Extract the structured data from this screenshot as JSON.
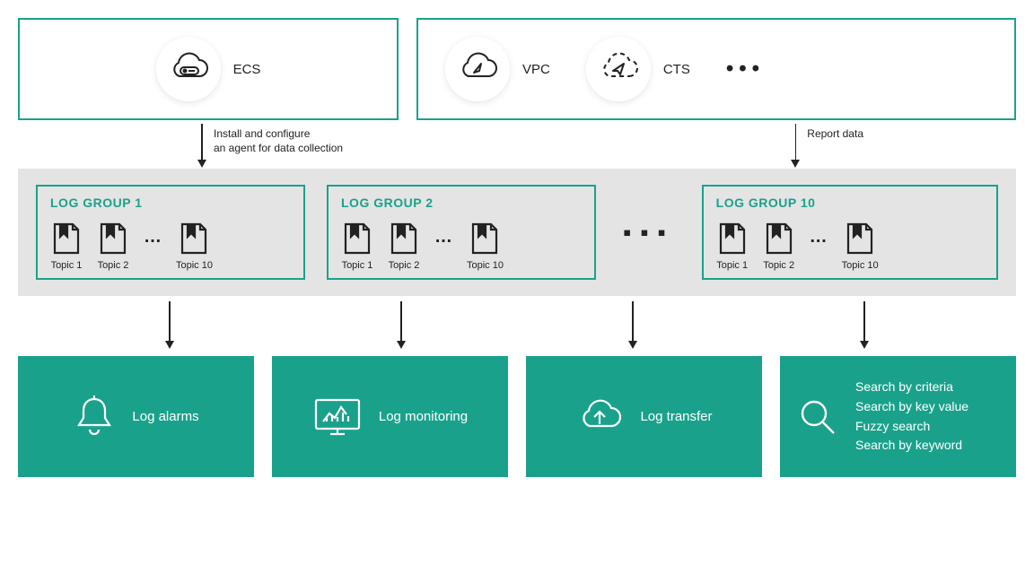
{
  "top": {
    "ecs": "ECS",
    "vpc": "VPC",
    "cts": "CTS"
  },
  "arrows": {
    "install": "Install and configure\nan agent for data collection",
    "report": "Report data"
  },
  "groups": {
    "g1": {
      "title": "LOG GROUP 1",
      "t1": "Topic 1",
      "t2": "Topic 2",
      "t10": "Topic 10"
    },
    "g2": {
      "title": "LOG GROUP 2",
      "t1": "Topic 1",
      "t2": "Topic 2",
      "t10": "Topic 10"
    },
    "g10": {
      "title": "LOG GROUP 10",
      "t1": "Topic 1",
      "t2": "Topic 2",
      "t10": "Topic 10"
    }
  },
  "bottom": {
    "alarms": "Log alarms",
    "monitoring": "Log monitoring",
    "transfer": "Log transfer",
    "search": {
      "criteria": "Search by criteria",
      "keyvalue": "Search by key value",
      "fuzzy": "Fuzzy search",
      "keyword": "Search by keyword"
    }
  }
}
